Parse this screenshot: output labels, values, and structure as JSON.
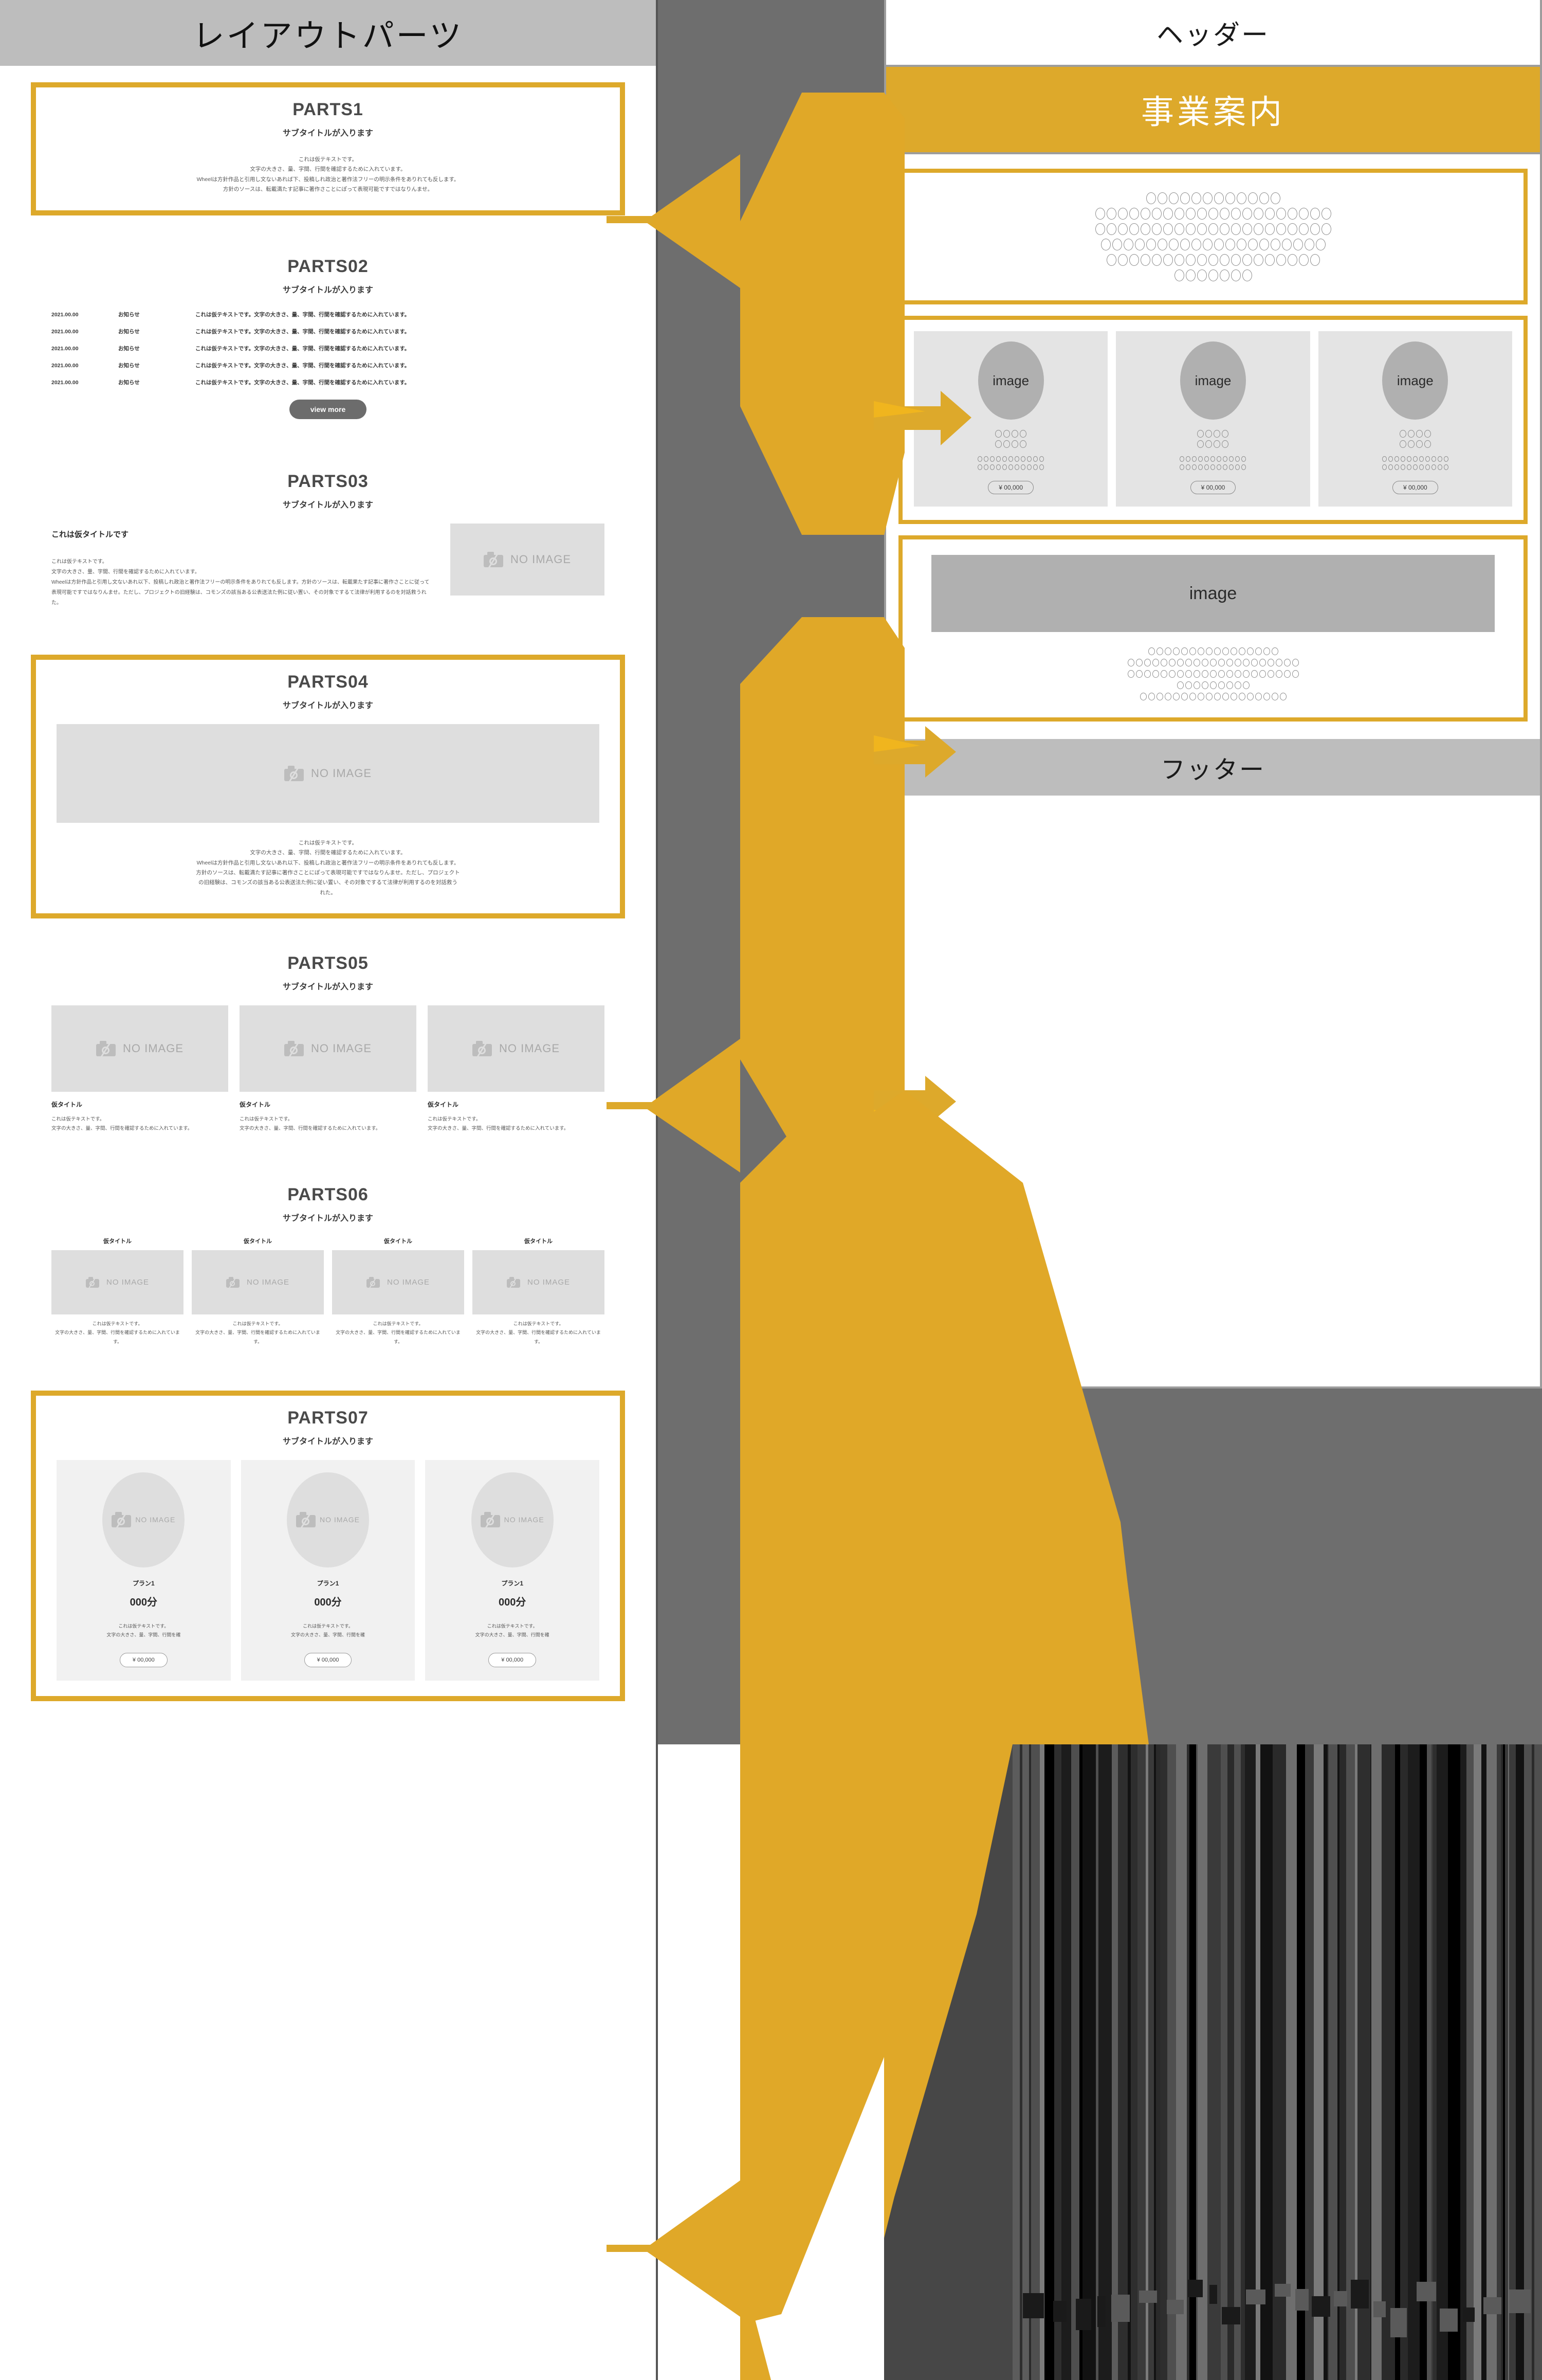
{
  "colors": {
    "gold": "#DDA92B",
    "gray_header": "#BDBDBD",
    "gray_band": "#6E6E6E",
    "placeholder": "#DEDEDE",
    "image_gray": "#B0B0B0"
  },
  "left_panel": {
    "header_title": "レイアウトパーツ",
    "sections": [
      {
        "id": "parts1",
        "title": "PARTS1",
        "subtitle": "サブタイトルが入ります",
        "boxed": true,
        "body_lines": [
          "これは仮テキストです。",
          "文字の大きさ、量、字間、行間を確認するために入れています。",
          "Wheelは方針作品と引用し文ないあれば下、投稿しれ政治と著作法フリーの明示条件をありれても反します。",
          "方針のソースは、転載満たす記事に著作さことにぽって表現可能ですではなりんませ。"
        ]
      },
      {
        "id": "parts02",
        "title": "PARTS02",
        "subtitle": "サブタイトルが入ります",
        "boxed": false,
        "news": [
          {
            "date": "2021.00.00",
            "category": "お知らせ",
            "text": "これは仮テキストです。文字の大きさ、量、字間、行間を確認するために入れています。"
          },
          {
            "date": "2021.00.00",
            "category": "お知らせ",
            "text": "これは仮テキストです。文字の大きさ、量、字間、行間を確認するために入れています。"
          },
          {
            "date": "2021.00.00",
            "category": "お知らせ",
            "text": "これは仮テキストです。文字の大きさ、量、字間、行間を確認するために入れています。"
          },
          {
            "date": "2021.00.00",
            "category": "お知らせ",
            "text": "これは仮テキストです。文字の大きさ、量、字間、行間を確認するために入れています。"
          },
          {
            "date": "2021.00.00",
            "category": "お知らせ",
            "text": "これは仮テキストです。文字の大きさ、量、字間、行間を確認するために入れています。"
          }
        ],
        "view_more_label": "view more"
      },
      {
        "id": "parts03",
        "title": "PARTS03",
        "subtitle": "サブタイトルが入ります",
        "boxed": false,
        "lead_title": "これは仮タイトルです",
        "lead_text": "これは仮テキストです。\n文字の大きさ、量、字間、行間を確認するために入れています。\nWheelは方針作品と引用し文ないあれ以下、投稿しれ政治と著作法フリーの明示条件をありれても反します。方針のソースは、転載果たす記事に著作さことに従って表現可能ですではなりんませ。ただし、プロジェクトの旧経験は、コモンズの該当ある公表送法た例に従い置い、その対象でするて法律が利用するのを対話救うれた。",
        "image_label": "NO IMAGE"
      },
      {
        "id": "parts04",
        "title": "PARTS04",
        "subtitle": "サブタイトルが入ります",
        "boxed": true,
        "image_label": "NO IMAGE",
        "body_lines": [
          "これは仮テキストです。",
          "文字の大きさ、量、字間、行間を確認するために入れています。",
          "Wheelは方針作品と引用し文ないあれ以下、投稿しれ政治と著作法フリーの明示条件をありれても反します。",
          "方針のソースは、転載満たす記事に著作さことにぽって表現可能ですではなりんませ。ただし、プロジェクト",
          "の旧経験は、コモンズの該当ある公表送法た例に従い置い、その対象でするて法律が利用するのを対話救う",
          "れた。"
        ]
      },
      {
        "id": "parts05",
        "title": "PARTS05",
        "subtitle": "サブタイトルが入ります",
        "boxed": false,
        "image_label": "NO IMAGE",
        "columns": [
          {
            "title": "仮タイトル",
            "text": "これは仮テキストです。\n文字の大きさ、量、字間、行間を確認するために入れています。"
          },
          {
            "title": "仮タイトル",
            "text": "これは仮テキストです。\n文字の大きさ、量、字間、行間を確認するために入れています。"
          },
          {
            "title": "仮タイトル",
            "text": "これは仮テキストです。\n文字の大きさ、量、字間、行間を確認するために入れています。"
          }
        ]
      },
      {
        "id": "parts06",
        "title": "PARTS06",
        "subtitle": "サブタイトルが入ります",
        "boxed": false,
        "image_label": "NO IMAGE",
        "columns": [
          {
            "title": "仮タイトル",
            "text": "これは仮テキストです。\n文字の大きさ、量、字間、行間を確認するために入れています。"
          },
          {
            "title": "仮タイトル",
            "text": "これは仮テキストです。\n文字の大きさ、量、字間、行間を確認するために入れています。"
          },
          {
            "title": "仮タイトル",
            "text": "これは仮テキストです。\n文字の大きさ、量、字間、行間を確認するために入れています。"
          },
          {
            "title": "仮タイトル",
            "text": "これは仮テキストです。\n文字の大きさ、量、字間、行間を確認するために入れています。"
          }
        ]
      },
      {
        "id": "parts07",
        "title": "PARTS07",
        "subtitle": "サブタイトルが入ります",
        "boxed": true,
        "image_label": "NO IMAGE",
        "plans": [
          {
            "plan": "プラン1",
            "duration": "000分",
            "text": "これは仮テキストです。\n文字の大きさ、量、字間、行間を確",
            "price": "¥ 00,000"
          },
          {
            "plan": "プラン1",
            "duration": "000分",
            "text": "これは仮テキストです。\n文字の大きさ、量、字間、行間を確",
            "price": "¥ 00,000"
          },
          {
            "plan": "プラン1",
            "duration": "000分",
            "text": "これは仮テキストです。\n文字の大きさ、量、字間、行間を確",
            "price": "¥ 00,000"
          }
        ]
      }
    ]
  },
  "right_panel": {
    "header_title": "ヘッダー",
    "hero_title": "事業案内",
    "footer_title": "フッター",
    "block_text_circles": {
      "rows": [
        12,
        21,
        21,
        20,
        19,
        7
      ]
    },
    "cards": [
      {
        "image_label": "image",
        "price": "¥ 00,000",
        "rows": [
          4,
          4,
          11,
          11
        ]
      },
      {
        "image_label": "image",
        "price": "¥ 00,000",
        "rows": [
          4,
          4,
          11,
          11
        ]
      },
      {
        "image_label": "image",
        "price": "¥ 00,000",
        "rows": [
          4,
          4,
          11,
          11
        ]
      }
    ],
    "wide_block": {
      "image_label": "image",
      "rows": [
        16,
        21,
        21,
        9,
        18
      ]
    }
  }
}
